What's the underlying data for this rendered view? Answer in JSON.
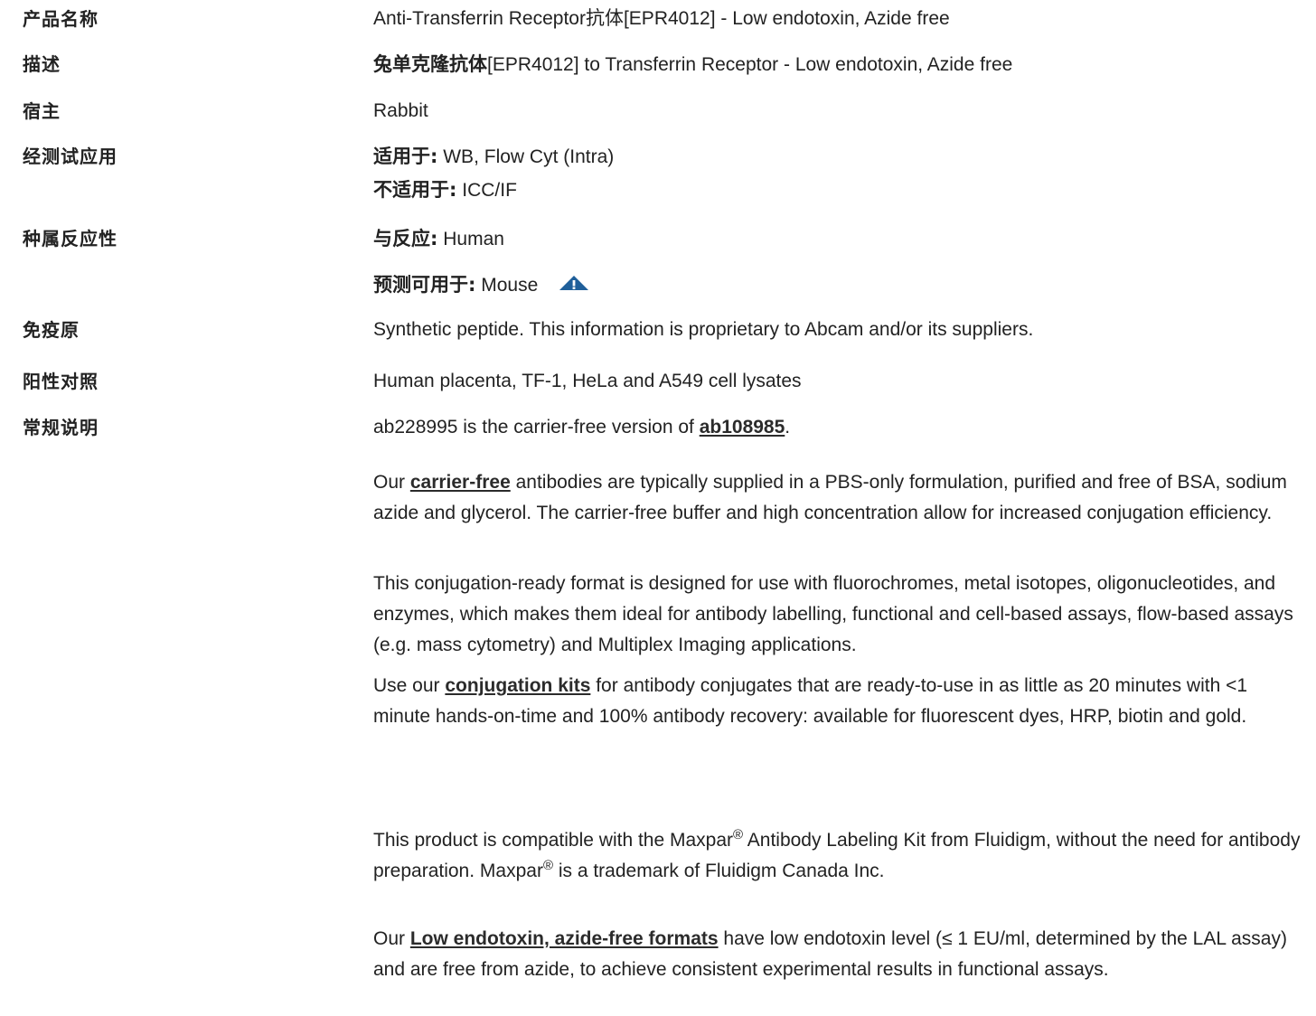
{
  "rows": {
    "name": {
      "label": "产品名称",
      "value": "Anti-Transferrin Receptor抗体[EPR4012] - Low endotoxin, Azide free"
    },
    "desc": {
      "label": "描述",
      "value_bold": "兔单克隆抗体",
      "value_rest": "[EPR4012] to Transferrin Receptor - Low endotoxin, Azide free"
    },
    "host": {
      "label": "宿主",
      "value": "Rabbit"
    },
    "apps": {
      "label": "经测试应用",
      "suitable_key": "适用于:",
      "suitable_val": " WB, Flow Cyt (Intra)",
      "unsuitable_key": "不适用于:",
      "unsuitable_val": " ICC/IF"
    },
    "species": {
      "label": "种属反应性",
      "react_key": "与反应:",
      "react_val": " Human",
      "pred_key": "预测可用于:",
      "pred_val": " Mouse",
      "warn_icon": "warning-triangle-icon"
    },
    "immunogen": {
      "label": "免疫原",
      "value": "Synthetic peptide. This information is proprietary to Abcam and/or its suppliers."
    },
    "positive": {
      "label": "阳性对照",
      "value": "Human placenta, TF-1, HeLa and A549 cell lysates"
    },
    "notes": {
      "label": "常规说明",
      "p0_pre": "ab228995 is the carrier-free version of ",
      "p0_link": "ab108985",
      "p0_post": ".",
      "p1_pre": "Our ",
      "p1_link": "carrier-free",
      "p1_post": " antibodies are typically supplied in a PBS-only formulation, purified and free of BSA, sodium azide and glycerol. The carrier-free buffer and high concentration allow for increased conjugation efficiency.",
      "p2": "This conjugation-ready format is designed for use with fluorochromes, metal isotopes, oligonucleotides, and enzymes, which makes them ideal for antibody labelling, functional and cell-based assays, flow-based assays (e.g. mass cytometry) and Multiplex Imaging applications.",
      "p3_pre": "Use our ",
      "p3_link": "conjugation kits",
      "p3_post": " for antibody conjugates that are ready-to-use in as little as 20 minutes with <1 minute hands-on-time and 100% antibody recovery: available for fluorescent dyes, HRP, biotin and gold.",
      "p4_a": "This product is compatible with the Maxpar",
      "p4_sup1": "®",
      "p4_b": " Antibody Labeling Kit from Fluidigm, without the need for antibody preparation. Maxpar",
      "p4_sup2": "®",
      "p4_c": " is a trademark of Fluidigm Canada Inc.",
      "p5_pre": "Our ",
      "p5_link": "Low endotoxin, azide-free formats",
      "p5_post": " have low endotoxin level (≤ 1 EU/ml, determined by the LAL assay) and are free from azide, to achieve consistent experimental results in functional assays."
    }
  },
  "colors": {
    "text": "#222222",
    "icon": "#1f5f9a"
  }
}
